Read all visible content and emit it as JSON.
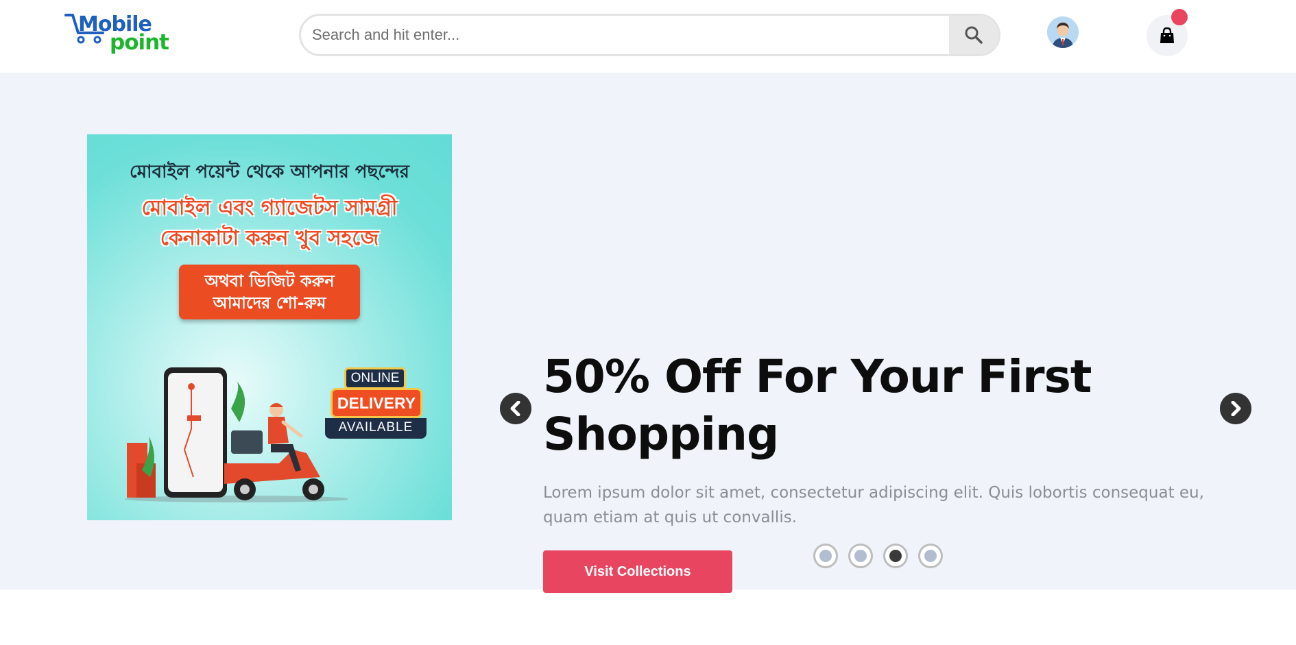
{
  "header": {
    "logo": {
      "text_top": "Mobile",
      "text_bottom": "point"
    },
    "search": {
      "placeholder": "Search and hit enter...",
      "icon": "search-icon"
    },
    "avatar_icon": "user-avatar",
    "cart": {
      "icon": "shopping-bag-icon",
      "badge_color": "#e84561"
    }
  },
  "hero": {
    "banner": {
      "line1": "মোবাইল পয়েন্ট থেকে আপনার  পছন্দের",
      "line2a": "মোবাইল এবং গ্যাজেটস সামগ্রী",
      "line2b": "কেনাকাটা করুন খুব সহজে",
      "box_a": "অথবা ভিজিট করুন",
      "box_b": "আমাদের শো-রুম",
      "badge_online": "ONLINE",
      "badge_delivery": "DELIVERY",
      "badge_available": "AVAILABLE"
    },
    "title": "50% Off For Your First Shopping",
    "text": "Lorem ipsum dolor sit amet, consectetur adipiscing elit. Quis lobortis consequat eu, quam etiam at quis ut convallis.",
    "button_label": "Visit Collections",
    "slides": {
      "count": 4,
      "active_index": 2
    },
    "colors": {
      "accent": "#e84561",
      "background": "#f0f3fa"
    }
  }
}
